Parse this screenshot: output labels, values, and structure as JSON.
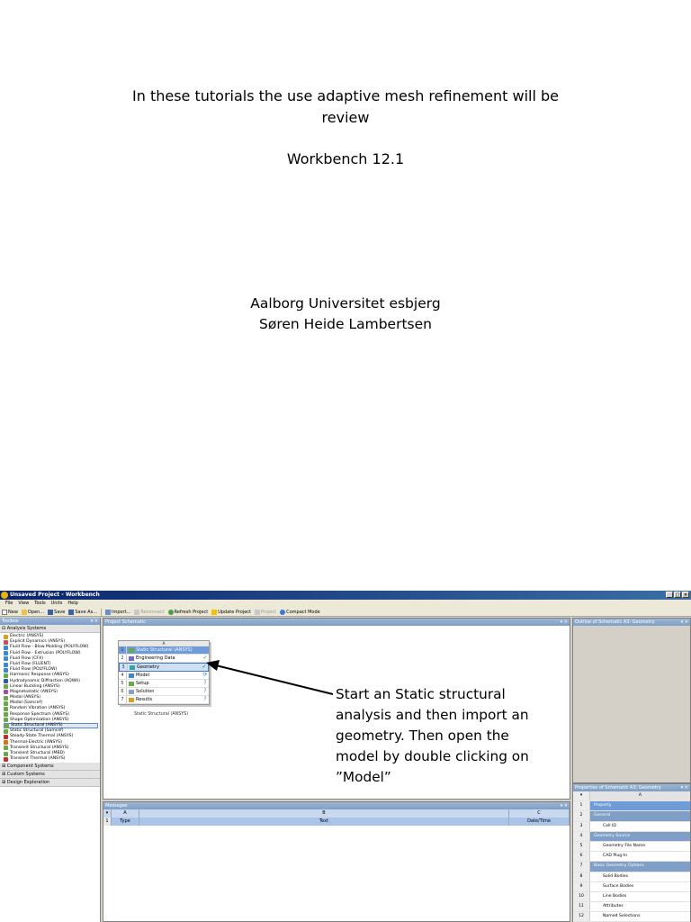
{
  "slide": {
    "title_line1": "In these tutorials the use adaptive mesh refinement will be",
    "title_line2": "review",
    "subtitle": "Workbench 12.1",
    "author_line1": "Aalborg Universitet esbjerg",
    "author_line2": "Søren Heide Lambertsen"
  },
  "window": {
    "title": "Unsaved Project - Workbench",
    "menu": [
      "File",
      "View",
      "Tools",
      "Units",
      "Help"
    ],
    "toolbar": {
      "new": "New",
      "open": "Open...",
      "save": "Save",
      "save_as": "Save As...",
      "import": "Import...",
      "reconnect": "Reconnect",
      "refresh": "Refresh Project",
      "update": "Update Project",
      "project": "Project",
      "compact": "Compact Mode"
    }
  },
  "toolbox": {
    "title": "Toolbox",
    "group_analysis": "Analysis Systems",
    "items": [
      "Electric (ANSYS)",
      "Explicit Dynamics (ANSYS)",
      "Fluid Flow - Blow Molding (POLYFLOW)",
      "Fluid Flow - Extrusion (POLYFLOW)",
      "Fluid Flow (CFX)",
      "Fluid Flow (FLUENT)",
      "Fluid Flow (POLYFLOW)",
      "Harmonic Response (ANSYS)",
      "Hydrodynamic Diffraction (AQWA)",
      "Linear Buckling (ANSYS)",
      "Magnetostatic (ANSYS)",
      "Modal (ANSYS)",
      "Modal (Samcef)",
      "Random Vibration (ANSYS)",
      "Response Spectrum (ANSYS)",
      "Shape Optimization (ANSYS)",
      "Static Structural (ANSYS)",
      "Static Structural (Samcef)",
      "Steady-State Thermal (ANSYS)",
      "Thermal-Electric (ANSYS)",
      "Transient Structural (ANSYS)",
      "Transient Structural (MBD)",
      "Transient Thermal (ANSYS)"
    ],
    "group_component": "Component Systems",
    "group_custom": "Custom Systems",
    "group_design": "Design Exploration"
  },
  "schematic": {
    "title": "Project Schematic",
    "system_header": "Static Structural (ANSYS)",
    "cells": [
      {
        "num": "2",
        "label": "Engineering Data",
        "status": "✓"
      },
      {
        "num": "3",
        "label": "Geometry",
        "status": "✓"
      },
      {
        "num": "4",
        "label": "Model",
        "status": "⟳"
      },
      {
        "num": "5",
        "label": "Setup",
        "status": "?"
      },
      {
        "num": "6",
        "label": "Solution",
        "status": "?"
      },
      {
        "num": "7",
        "label": "Results",
        "status": "?"
      }
    ],
    "header_num": "1",
    "header_col": "A",
    "caption": "Static Structural (ANSYS)"
  },
  "messages": {
    "title": "Messages",
    "cols": [
      "A",
      "B",
      "C"
    ],
    "row_num": "1",
    "row": [
      "Type",
      "Text",
      "Date/Time"
    ]
  },
  "outline": {
    "title": "Outline of Schematic A3: Geometry"
  },
  "properties": {
    "title": "Properties of Schematic A3: Geometry",
    "col": "A",
    "rows": [
      {
        "num": "1",
        "label": "Property",
        "kind": "hdr"
      },
      {
        "num": "2",
        "label": "General",
        "kind": "cat"
      },
      {
        "num": "3",
        "label": "Cell ID",
        "kind": "item"
      },
      {
        "num": "4",
        "label": "Geometry Source",
        "kind": "cat"
      },
      {
        "num": "5",
        "label": "Geometry File Name",
        "kind": "item"
      },
      {
        "num": "6",
        "label": "CAD Plug-In",
        "kind": "item"
      },
      {
        "num": "7",
        "label": "Basic Geometry Options",
        "kind": "cat"
      },
      {
        "num": "8",
        "label": "Solid Bodies",
        "kind": "item"
      },
      {
        "num": "9",
        "label": "Surface Bodies",
        "kind": "item"
      },
      {
        "num": "10",
        "label": "Line Bodies",
        "kind": "item"
      },
      {
        "num": "11",
        "label": "Attributes",
        "kind": "item"
      },
      {
        "num": "12",
        "label": "Named Selections",
        "kind": "item"
      },
      {
        "num": "13",
        "label": "Material Properties",
        "kind": "item"
      }
    ]
  },
  "annotation": {
    "line1": "Start an Static structural",
    "line2": "analysis and then import an",
    "line3": "geometry. Then open the",
    "line4": "model by double clicking on",
    "line5": "”Model”"
  },
  "colors": {
    "title_bar": "#0a246a",
    "panel_head": "#7f9fc6",
    "selection": "#cfe0f3",
    "ok_green": "#2a7a2a"
  }
}
